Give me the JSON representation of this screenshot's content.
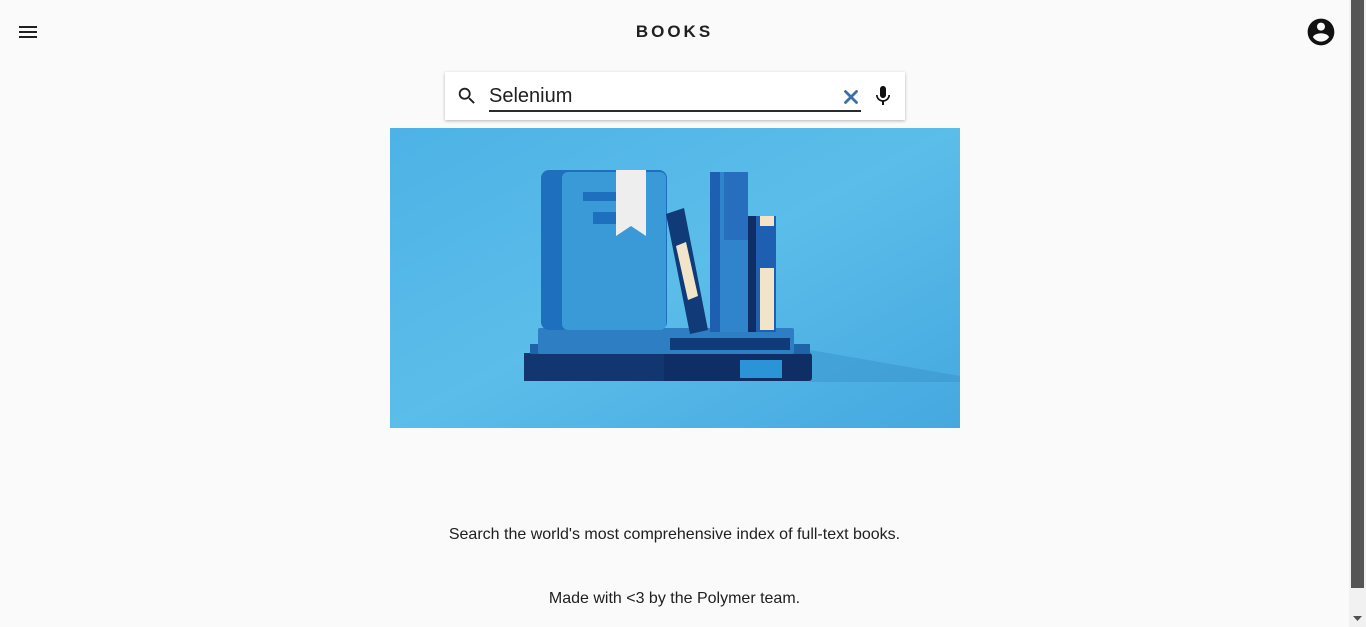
{
  "header": {
    "title": "BOOKS",
    "menu_icon": "hamburger-menu-icon",
    "account_icon": "account-circle-icon"
  },
  "search": {
    "value": "Selenium",
    "search_icon": "search-icon",
    "clear_icon": "close-icon",
    "mic_icon": "microphone-icon"
  },
  "hero": {
    "illustration": "books-illustration"
  },
  "footer": {
    "tagline": "Search the world's most comprehensive index of full-text books.",
    "credits": "Made with <3 by the Polymer team."
  },
  "colors": {
    "background": "#fafafa",
    "hero_background": "#4fb3e8",
    "clear_icon": "#3a6fa8"
  }
}
